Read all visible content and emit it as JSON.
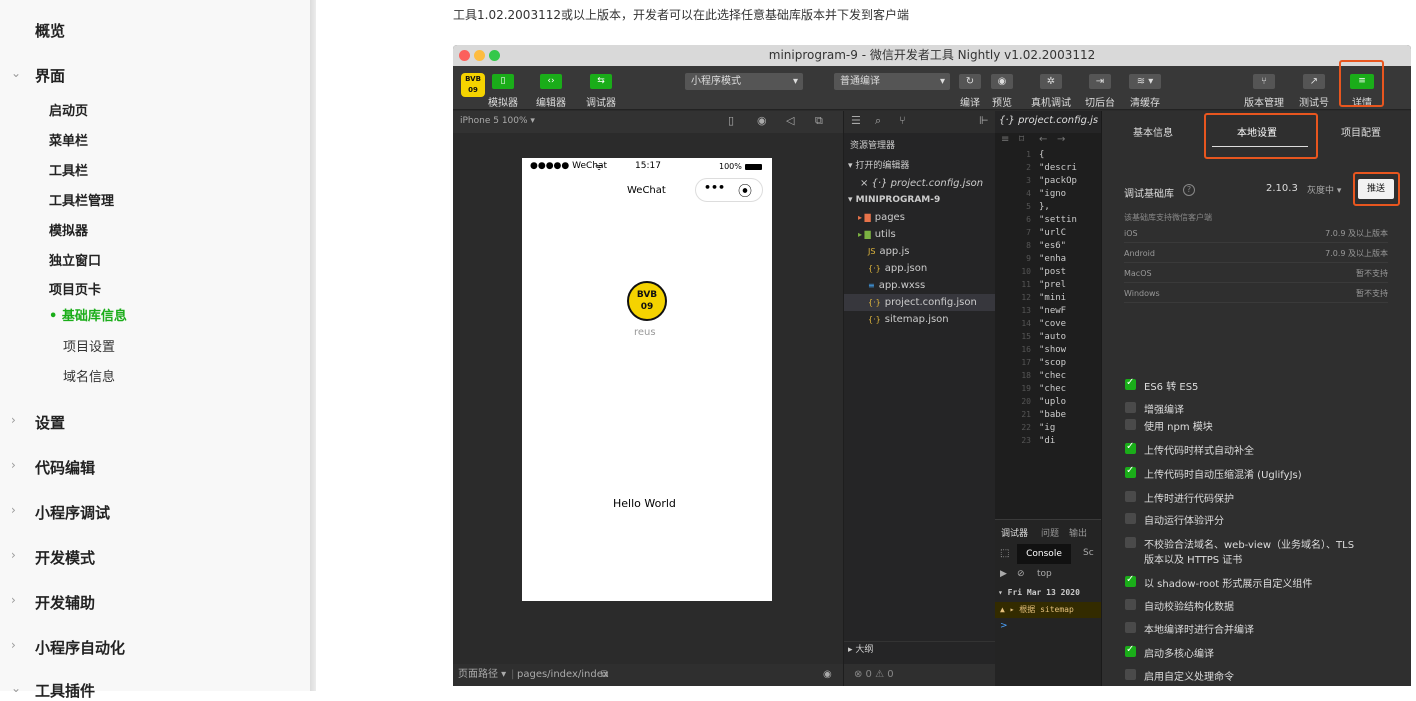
{
  "sidebar": {
    "items": [
      {
        "label": "概览"
      },
      {
        "label": "界面",
        "chevron": "⌄"
      },
      {
        "label": "设置",
        "chevron": "›"
      },
      {
        "label": "代码编辑",
        "chevron": "›"
      },
      {
        "label": "小程序调试",
        "chevron": "›"
      },
      {
        "label": "开发模式",
        "chevron": "›"
      },
      {
        "label": "开发辅助",
        "chevron": "›"
      },
      {
        "label": "小程序自动化",
        "chevron": "›"
      },
      {
        "label": "工具插件",
        "chevron": "⌄"
      }
    ],
    "sub_items": [
      {
        "label": "启动页"
      },
      {
        "label": "菜单栏"
      },
      {
        "label": "工具栏"
      },
      {
        "label": "工具栏管理"
      },
      {
        "label": "模拟器"
      },
      {
        "label": "独立窗口"
      },
      {
        "label": "项目页卡"
      }
    ],
    "active_item": "• 基础库信息",
    "sub2_items": [
      {
        "label": "项目设置"
      },
      {
        "label": "域名信息"
      }
    ],
    "active_color": "#1aad19"
  },
  "doc": {
    "text": "工具1.02.2003112或以上版本，开发者可以在此选择任意基础库版本并下发到客户端"
  },
  "window": {
    "title": "miniprogram-9 - 微信开发者工具 Nightly v1.02.2003112"
  },
  "toolbar": {
    "logo_text": "BVB 09",
    "simulator_label": "模拟器",
    "editor_label": "编辑器",
    "debugger_label": "调试器",
    "mode_select": "小程序模式",
    "compile_select": "普通编译",
    "compile_label": "编译",
    "preview_label": "预览",
    "realdevice_label": "真机调试",
    "background_label": "切后台",
    "clearcache_label": "清缓存",
    "version_label": "版本管理",
    "testid_label": "测试号",
    "details_label": "详情"
  },
  "simulator": {
    "device": "iPhone 5 100% ▾",
    "carrier": "●●●●● WeChat",
    "wifi_icon": "wifi-icon",
    "time": "15:17",
    "battery": "100%",
    "nav_title": "WeChat",
    "logo_name": "reus",
    "hello": "Hello World",
    "path_label": "页面路径 ▾",
    "path_value": "pages/index/index"
  },
  "explorer": {
    "header": "资源管理器",
    "open_editors": "▾ 打开的编辑器",
    "open_file": "× {·} project.config.json",
    "project": "▾ MINIPROGRAM-9",
    "files": [
      {
        "name": "pages",
        "icon": "▸ ▇",
        "color": "#e8734a"
      },
      {
        "name": "utils",
        "icon": "▸ ▇",
        "color": "#7cb342"
      },
      {
        "name": "app.js",
        "icon": "JS",
        "color": "#e0b63d"
      },
      {
        "name": "app.json",
        "icon": "{·}",
        "color": "#e0b63d"
      },
      {
        "name": "app.wxss",
        "icon": "≡",
        "color": "#42a5f5"
      },
      {
        "name": "project.config.json",
        "icon": "{·}",
        "color": "#e0b63d"
      },
      {
        "name": "sitemap.json",
        "icon": "{·}",
        "color": "#e0b63d"
      }
    ],
    "outline": "▸ 大纲",
    "status": "⊗ 0 ⚠ 0"
  },
  "editor": {
    "tab": "{·} project.config.js",
    "lines": [
      "{",
      "  \"descri",
      "  \"packOp",
      "    \"igno",
      "  },",
      "  \"settin",
      "    \"urlC",
      "    \"es6\"",
      "    \"enha",
      "    \"post",
      "    \"prel",
      "    \"mini",
      "    \"newF",
      "    \"cove",
      "    \"auto",
      "    \"show",
      "    \"scop",
      "    \"chec",
      "    \"chec",
      "    \"uplo",
      "    \"babe",
      "      \"ig",
      "      \"di"
    ],
    "console_tabs": [
      "调试器",
      "问题",
      "输出"
    ],
    "console_label": "Console",
    "console_extra": "Sc",
    "console_top": "top",
    "console_date": "▾ Fri Mar 13 2020",
    "console_warn": "▲ ▸ 根据 sitemap",
    "console_prompt": ">"
  },
  "detail": {
    "tabs": [
      "基本信息",
      "本地设置",
      "项目配置"
    ],
    "lib_label": "调试基础库",
    "lib_help_icon": "help-icon",
    "lib_version": "2.10.3",
    "lib_gray": "灰度中 ▾",
    "push_label": "推送",
    "support_label": "该基础库支持微信客户端",
    "platforms": [
      {
        "name": "iOS",
        "value": "7.0.9 及以上版本"
      },
      {
        "name": "Android",
        "value": "7.0.9 及以上版本"
      },
      {
        "name": "MacOS",
        "value": "暂不支持"
      },
      {
        "name": "Windows",
        "value": "暂不支持"
      }
    ],
    "options": [
      {
        "label": "ES6 转 ES5",
        "checked": true
      },
      {
        "label": "增强编译",
        "checked": false
      },
      {
        "label": "使用 npm 模块",
        "checked": false
      },
      {
        "label": "上传代码时样式自动补全",
        "checked": true
      },
      {
        "label": "上传代码时自动压缩混淆 (UglifyJs)",
        "checked": true
      },
      {
        "label": "上传时进行代码保护",
        "checked": false
      },
      {
        "label": "自动运行体验评分",
        "checked": false
      },
      {
        "label": "不校验合法域名、web-view（业务域名）、TLS",
        "checked": false,
        "line2": "版本以及 HTTPS 证书"
      },
      {
        "label": "以 shadow-root 形式展示自定义组件",
        "checked": true
      },
      {
        "label": "自动校验结构化数据",
        "checked": false
      },
      {
        "label": "本地编译时进行合并编译",
        "checked": false
      },
      {
        "label": "启动多核心编译",
        "checked": true
      },
      {
        "label": "启用自定义处理命令",
        "checked": false
      }
    ],
    "highlight_color": "#e8561f"
  }
}
